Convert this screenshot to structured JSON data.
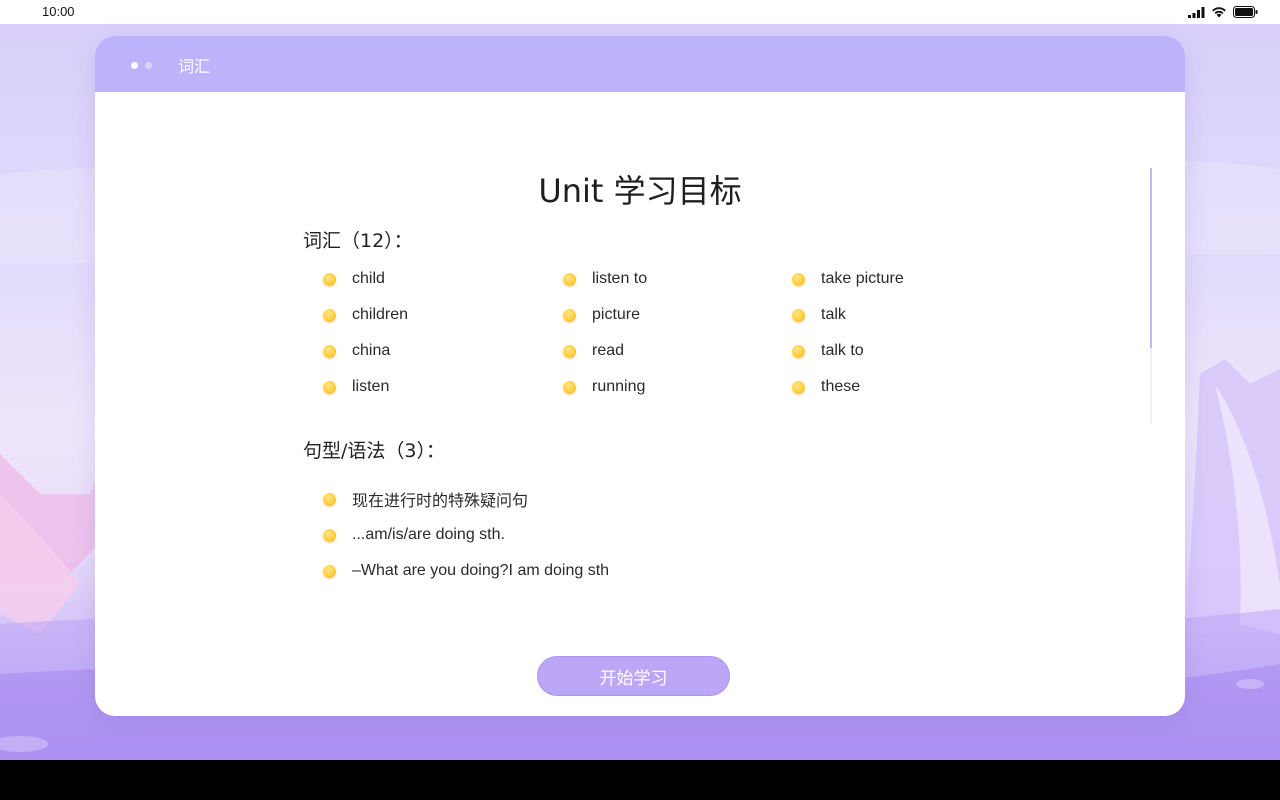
{
  "status_bar": {
    "time": "10:00",
    "icons": [
      "signal-icon",
      "wifi-icon",
      "battery-icon"
    ]
  },
  "header": {
    "title": "词汇",
    "page_dots": 2,
    "active_dot": 0
  },
  "main": {
    "title": "Unit 学习目标"
  },
  "vocab": {
    "heading": "词汇（12）：",
    "columns": [
      [
        "child",
        "children",
        "china",
        "listen"
      ],
      [
        "listen to",
        "picture",
        "read",
        "running"
      ],
      [
        "take picture",
        "talk",
        "talk to",
        "these"
      ]
    ]
  },
  "grammar": {
    "heading": "句型/语法（3）：",
    "items": [
      "现在进行时的特殊疑问句",
      "...am/is/are doing sth.",
      "–What are you doing?I am doing sth"
    ]
  },
  "start_button": {
    "label": "开始学习"
  },
  "colors": {
    "header_bg": "#bdb3fb",
    "button_bg": "#bba7f6",
    "bullet": "#ffcf3c",
    "background_top": "#d9d0fb",
    "background_bottom": "#a98ef0"
  }
}
